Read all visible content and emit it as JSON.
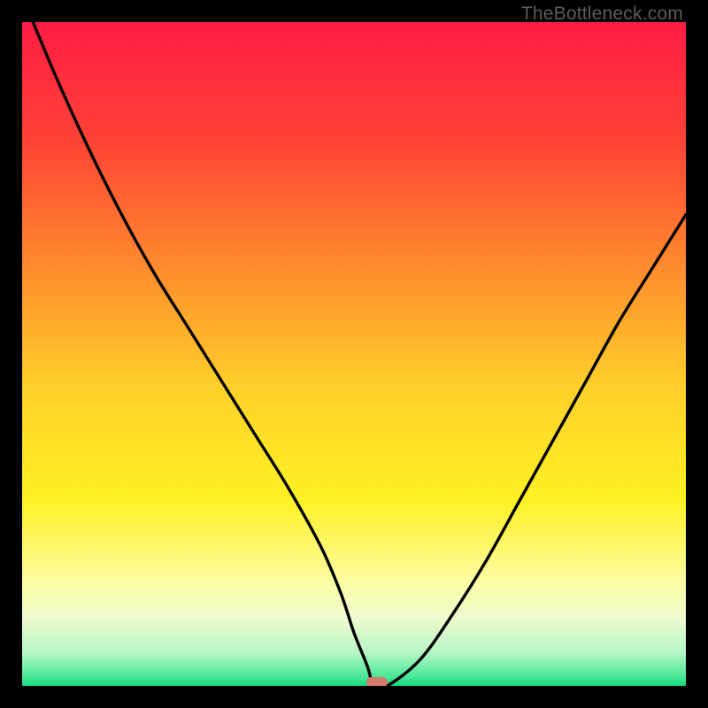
{
  "watermark": "TheBottleneck.com",
  "chart_data": {
    "type": "line",
    "title": "",
    "xlabel": "",
    "ylabel": "",
    "xlim": [
      0,
      100
    ],
    "ylim": [
      0,
      100
    ],
    "series": [
      {
        "name": "bottleneck-curve",
        "x": [
          0,
          5,
          10,
          15,
          20,
          25,
          30,
          35,
          40,
          45,
          48,
          50,
          52,
          53,
          55,
          60,
          65,
          70,
          75,
          80,
          85,
          90,
          95,
          100
        ],
        "values": [
          104,
          92,
          81,
          71,
          62,
          54,
          46,
          38,
          30,
          21,
          14,
          8,
          3,
          0,
          0,
          4,
          11,
          19,
          28,
          37,
          46,
          55,
          63,
          71
        ]
      }
    ],
    "marker": {
      "x": 53.5,
      "y": 0.5
    },
    "background_gradient": {
      "stops": [
        {
          "pos": 0.0,
          "color": "#ff1c44"
        },
        {
          "pos": 0.18,
          "color": "#ff4336"
        },
        {
          "pos": 0.35,
          "color": "#ff842e"
        },
        {
          "pos": 0.55,
          "color": "#ffd02a"
        },
        {
          "pos": 0.72,
          "color": "#fff123"
        },
        {
          "pos": 0.84,
          "color": "#fdfca0"
        },
        {
          "pos": 0.9,
          "color": "#eefbd0"
        },
        {
          "pos": 0.95,
          "color": "#b6f7c5"
        },
        {
          "pos": 0.985,
          "color": "#4de899"
        },
        {
          "pos": 1.0,
          "color": "#17db7e"
        }
      ]
    }
  }
}
